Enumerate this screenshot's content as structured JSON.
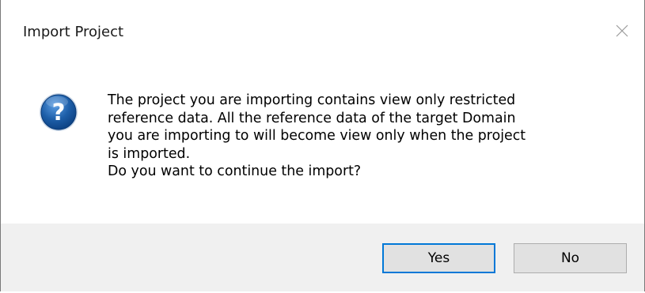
{
  "dialog": {
    "title": "Import Project",
    "icon": "question-icon",
    "message_lines": [
      "The project you are importing contains view only restricted",
      "reference data. All the reference data of the target Domain",
      "you are importing to will become view only when the project",
      "is imported.",
      "Do you want to continue the import?"
    ],
    "buttons": {
      "yes": "Yes",
      "no": "No"
    },
    "colors": {
      "icon_blue": "#1d5ea8",
      "footer_bg": "#f0f0f0",
      "default_button_border": "#0078d7"
    }
  }
}
